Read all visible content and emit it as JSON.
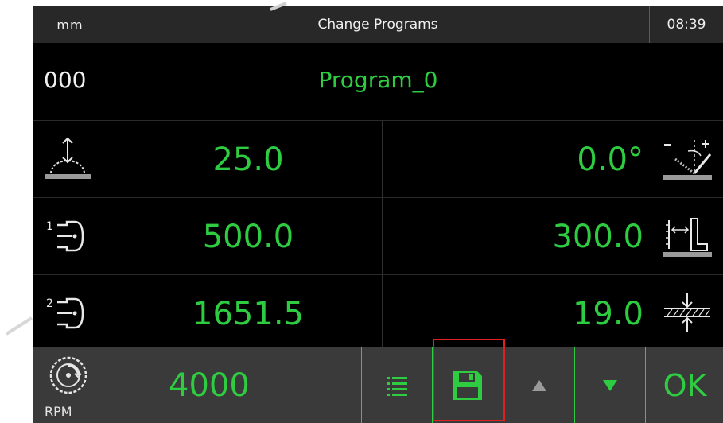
{
  "header": {
    "unit": "mm",
    "title": "Change Programs",
    "time": "08:39"
  },
  "program": {
    "number": "000",
    "name": "Program_0"
  },
  "rows": [
    {
      "left_icon": "blade-height-icon",
      "left_value": "25.0",
      "right_value": "0.0°",
      "right_icon": "blade-angle-icon"
    },
    {
      "left_icon": "pusher-1-icon",
      "left_value": "500.0",
      "right_value": "300.0",
      "right_icon": "fence-distance-icon"
    },
    {
      "left_icon": "pusher-2-icon",
      "left_value": "1651.5",
      "right_value": "19.0",
      "right_icon": "material-thickness-icon"
    }
  ],
  "bottom": {
    "rpm_icon": "saw-blade-rpm-icon",
    "rpm_label": "RPM",
    "rpm_value": "4000",
    "buttons": {
      "list_icon": "list-icon",
      "save_icon": "save-icon",
      "up_icon": "arrow-up-icon",
      "down_icon": "arrow-down-icon",
      "ok_label": "OK"
    }
  },
  "colors": {
    "accent": "#2ecc40",
    "highlight": "#e02020",
    "header_bg": "#282828",
    "bottom_bg": "#3a3a3a"
  }
}
